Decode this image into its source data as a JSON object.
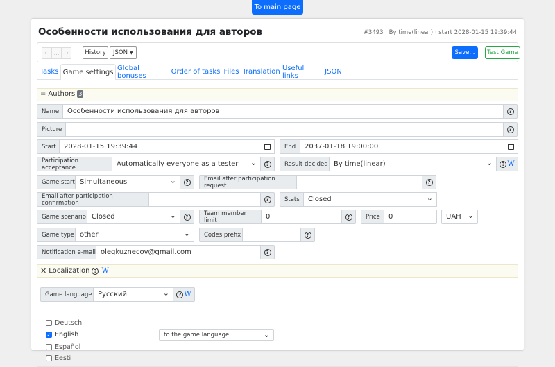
{
  "top_button": "To main page",
  "header": {
    "title": "Особенности использования для авторов",
    "meta": "#3493 · By time(linear) · start 2028-01-15 19:39:44"
  },
  "toolbar": {
    "nav": [
      "←",
      "…",
      "→"
    ],
    "history": "History",
    "json": "JSON",
    "save": "Save...",
    "test": "Test Game"
  },
  "tabs": [
    "Tasks",
    "Game settings",
    "Global bonuses",
    "Order of tasks",
    "Files",
    "Translation",
    "Useful links",
    "JSON"
  ],
  "authors": {
    "label": "Authors",
    "count": "3"
  },
  "form": {
    "name_label": "Name",
    "name_value": "Особенности использования для авторов",
    "picture_label": "Picture",
    "start_label": "Start",
    "start_value": "2028-01-15 19:39:44",
    "end_label": "End",
    "end_value": "2037-01-18 19:00:00",
    "participation_label": "Participation acceptance",
    "participation_value": "Automatically everyone as a tester",
    "result_label": "Result decided",
    "result_value": "By time(linear)",
    "game_start_label": "Game start",
    "game_start_value": "Simultaneous",
    "email_request_label": "Email after participation request",
    "email_confirm_label": "Email after participation confirmation",
    "stats_label": "Stats",
    "stats_value": "Closed",
    "scenario_label": "Game scenario",
    "scenario_value": "Closed",
    "team_limit_label": "Team member limit",
    "team_limit_value": "0",
    "price_label": "Price",
    "price_value": "0",
    "currency_value": "UAH",
    "game_type_label": "Game type",
    "game_type_value": "other",
    "codes_prefix_label": "Codes prefix",
    "notification_label": "Notification e-mail",
    "notification_value": "olegkuznecov@gmail.com",
    "help_symbol": "?",
    "wiki_symbol": "W"
  },
  "localization": {
    "title": "Localization",
    "game_language_label": "Game language",
    "game_language_value": "Русский",
    "languages": [
      {
        "name": "Deutsch",
        "checked": false
      },
      {
        "name": "English",
        "checked": true
      },
      {
        "name": "Español",
        "checked": false
      },
      {
        "name": "Eesti",
        "checked": false
      }
    ],
    "english_mode": "to the game language"
  }
}
